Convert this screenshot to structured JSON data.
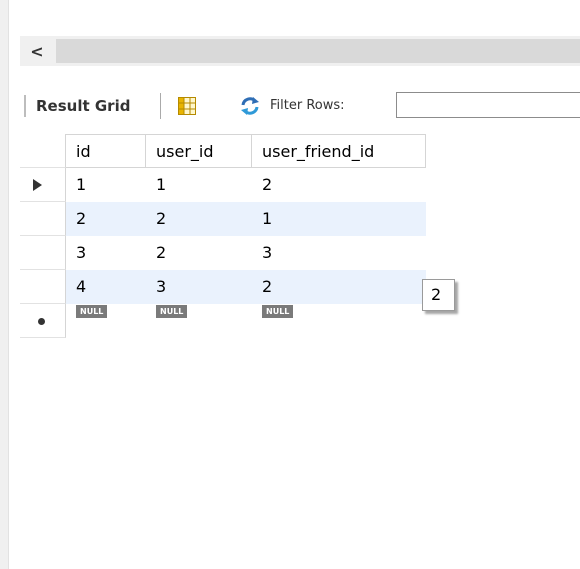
{
  "scroll": {
    "left_arrow": "<"
  },
  "toolbar": {
    "title": "Result Grid",
    "filter_label": "Filter Rows:",
    "filter_value": ""
  },
  "grid": {
    "columns": [
      "id",
      "user_id",
      "user_friend_id"
    ],
    "rows": [
      [
        "1",
        "1",
        "2"
      ],
      [
        "2",
        "2",
        "1"
      ],
      [
        "3",
        "2",
        "3"
      ],
      [
        "4",
        "3",
        "2"
      ]
    ],
    "null_label": "NULL",
    "current_row": 1
  },
  "tooltip": {
    "text": "2"
  },
  "colors": {
    "alt_row": "#eaf2fd",
    "null_badge": "#7a7a7a",
    "refresh_icon": "#2f6eb5",
    "grid_icon": "#e8b400"
  },
  "icons": [
    "chevron-left-icon",
    "grid-icon",
    "refresh-icon",
    "row-pointer-icon",
    "new-row-icon"
  ]
}
